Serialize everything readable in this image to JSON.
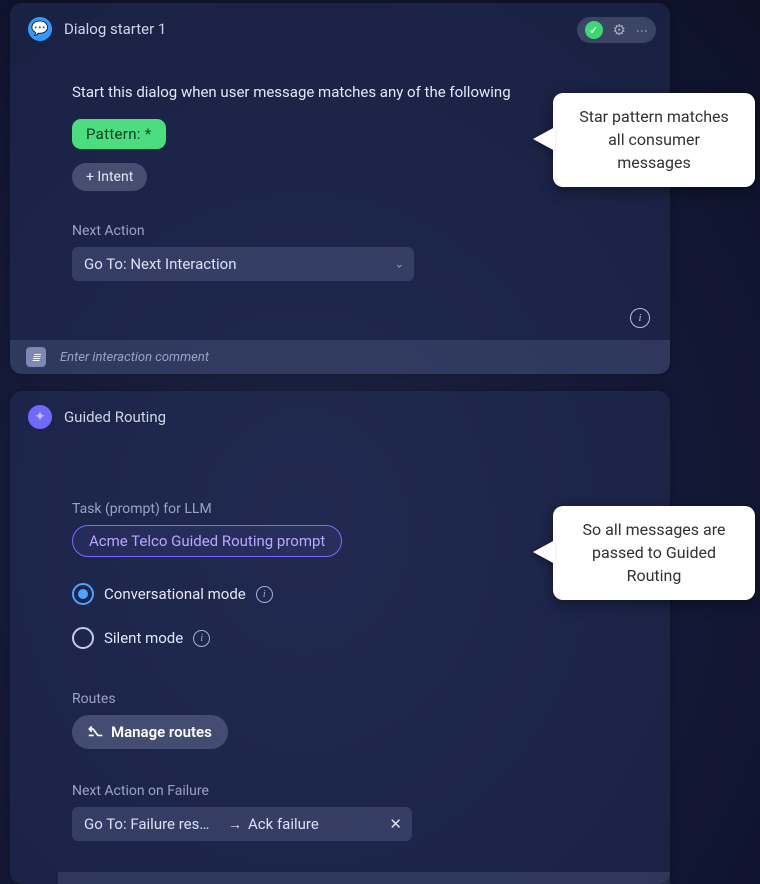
{
  "card1": {
    "title": "Dialog starter 1",
    "instruction": "Start this dialog when user message matches any of the following",
    "pattern_chip": "Pattern:  *",
    "intent_chip": "+ Intent",
    "next_action_label": "Next Action",
    "next_action_value": "Go To:  Next Interaction",
    "comment_placeholder": "Enter interaction comment"
  },
  "card2": {
    "title": "Guided Routing",
    "task_label": "Task (prompt) for LLM",
    "task_chip": "Acme Telco Guided Routing prompt",
    "mode_conversational": "Conversational mode",
    "mode_silent": "Silent mode",
    "routes_label": "Routes",
    "manage_routes": "Manage routes",
    "next_fail_label": "Next Action on Failure",
    "fail_goto": "Go To: Failure resp…",
    "fail_target": "Ack failure"
  },
  "callouts": {
    "c1": "Star pattern matches all consumer messages",
    "c2": "So all messages are passed to Guided Routing"
  },
  "icons": {
    "chat": "💬",
    "routing": "✦",
    "check": "✓",
    "gear": "⚙",
    "info": "i",
    "branch": "⎇",
    "arrow": "→",
    "close": "✕",
    "chevron": "⌄",
    "kebab": "⋮",
    "comment": "≣"
  },
  "colors": {
    "accent_green": "#4ade80",
    "accent_blue": "#4da3ff",
    "accent_purple": "#7a6cff"
  }
}
